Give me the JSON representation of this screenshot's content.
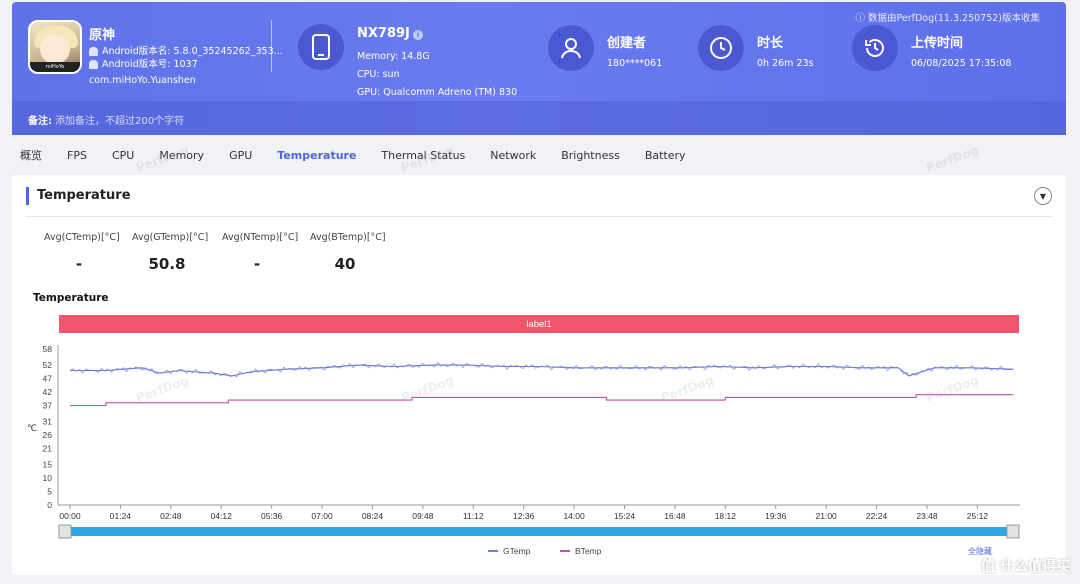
{
  "header": {
    "credit": "数据由PerfDog(11.3.250752)版本收集",
    "app": {
      "name": "原神",
      "version_name": "Android版本名: 5.8.0_35245262_353...",
      "version_code": "Android版本号: 1037",
      "package": "com.miHoYo.Yuanshen",
      "icon_tag": "miHoYo"
    },
    "device": {
      "name": "NX789J",
      "memory": "Memory: 14.8G",
      "cpu": "CPU: sun",
      "gpu": "GPU: Qualcomm Adreno (TM) 830"
    },
    "creator": {
      "title": "创建者",
      "value": "180****061"
    },
    "duration": {
      "title": "时长",
      "value": "0h 26m 23s"
    },
    "upload": {
      "title": "上传时间",
      "value": "06/08/2025 17:35:08"
    },
    "note_label": "备注:",
    "note_placeholder": "添加备注，不超过200个字符"
  },
  "tabs": [
    "概览",
    "FPS",
    "CPU",
    "Memory",
    "GPU",
    "Temperature",
    "Thermal Status",
    "Network",
    "Brightness",
    "Battery"
  ],
  "active_tab": "Temperature",
  "section_title": "Temperature",
  "stats": [
    {
      "label": "Avg(CTemp)[°C]",
      "value": "-"
    },
    {
      "label": "Avg(GTemp)[°C]",
      "value": "50.8"
    },
    {
      "label": "Avg(NTemp)[°C]",
      "value": "-"
    },
    {
      "label": "Avg(BTemp)[°C]",
      "value": "40"
    }
  ],
  "watermark": "PerfDog",
  "site_mark": "值 什么值得买",
  "chart_data": {
    "type": "line",
    "title": "Temperature",
    "band_label": "label1",
    "ylabel": "℃",
    "ylim": [
      0,
      58
    ],
    "yticks": [
      0,
      5,
      10,
      15,
      21,
      26,
      31,
      37,
      42,
      47,
      52,
      58
    ],
    "xlim_seconds": [
      0,
      1583
    ],
    "xticks": [
      "00:00",
      "01:24",
      "02:48",
      "04:12",
      "05:36",
      "07:00",
      "08:24",
      "09:48",
      "11:12",
      "12:36",
      "14:00",
      "15:24",
      "16:48",
      "18:12",
      "19:36",
      "21:00",
      "22:24",
      "23:48",
      "25:12"
    ],
    "legend": "bottom",
    "zoom_link": "全隐藏",
    "series": [
      {
        "name": "GTemp",
        "color": "#6c7fd8",
        "x_minutes": [
          0,
          1,
          2,
          2.5,
          3,
          4,
          4.5,
          5,
          6,
          7,
          8,
          9,
          10,
          11,
          12,
          13,
          14,
          15,
          16,
          17,
          18,
          19,
          20,
          21,
          22,
          23,
          23.3,
          24,
          25,
          26.2
        ],
        "values": [
          50,
          50,
          51,
          49,
          50,
          49,
          48,
          49.5,
          50.5,
          51,
          52,
          51.5,
          52,
          52,
          51.5,
          51.5,
          51,
          51,
          51,
          51,
          51.5,
          51,
          51.5,
          51.5,
          51,
          51,
          48,
          51,
          51,
          50.5
        ]
      },
      {
        "name": "BTemp",
        "color": "#c64db0",
        "x_minutes": [
          0,
          1.0,
          1.0,
          4.4,
          4.4,
          9.5,
          9.5,
          14.9,
          14.9,
          18.2,
          18.2,
          23.5,
          23.5,
          26.2
        ],
        "values": [
          37,
          37,
          38,
          38,
          39,
          39,
          40,
          40,
          39,
          39,
          40,
          40,
          41,
          41
        ]
      }
    ]
  }
}
